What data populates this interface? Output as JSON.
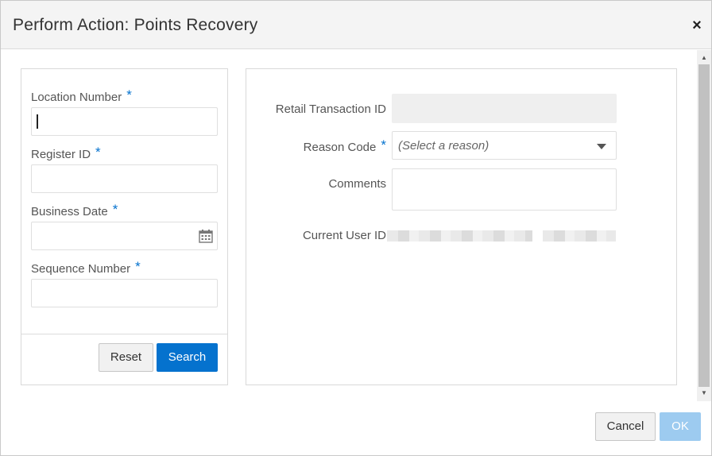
{
  "dialog": {
    "title": "Perform Action: Points Recovery",
    "close_glyph": "×"
  },
  "search_form": {
    "location_number_label": "Location Number",
    "register_id_label": "Register ID",
    "business_date_label": "Business Date",
    "sequence_number_label": "Sequence Number",
    "required_marker": "*",
    "location_number_value": "",
    "register_id_value": "",
    "business_date_value": "",
    "sequence_number_value": "",
    "reset_label": "Reset",
    "search_label": "Search"
  },
  "details": {
    "retail_transaction_label": "Retail Transaction ID",
    "reason_code_label": "Reason Code",
    "reason_code_placeholder": "(Select a reason)",
    "comments_label": "Comments",
    "current_user_label": "Current User ID"
  },
  "footer": {
    "cancel_label": "Cancel",
    "ok_label": "OK"
  },
  "icons": {
    "close": "close-icon",
    "calendar": "calendar-icon",
    "dropdown": "chevron-down-icon",
    "scroll_up": "scroll-up-arrow-icon",
    "scroll_down": "scroll-down-arrow-icon"
  },
  "colors": {
    "accent": "#0572ce",
    "ok_disabled": "#9dcbf0",
    "titlebar_bg": "#f4f4f4"
  }
}
